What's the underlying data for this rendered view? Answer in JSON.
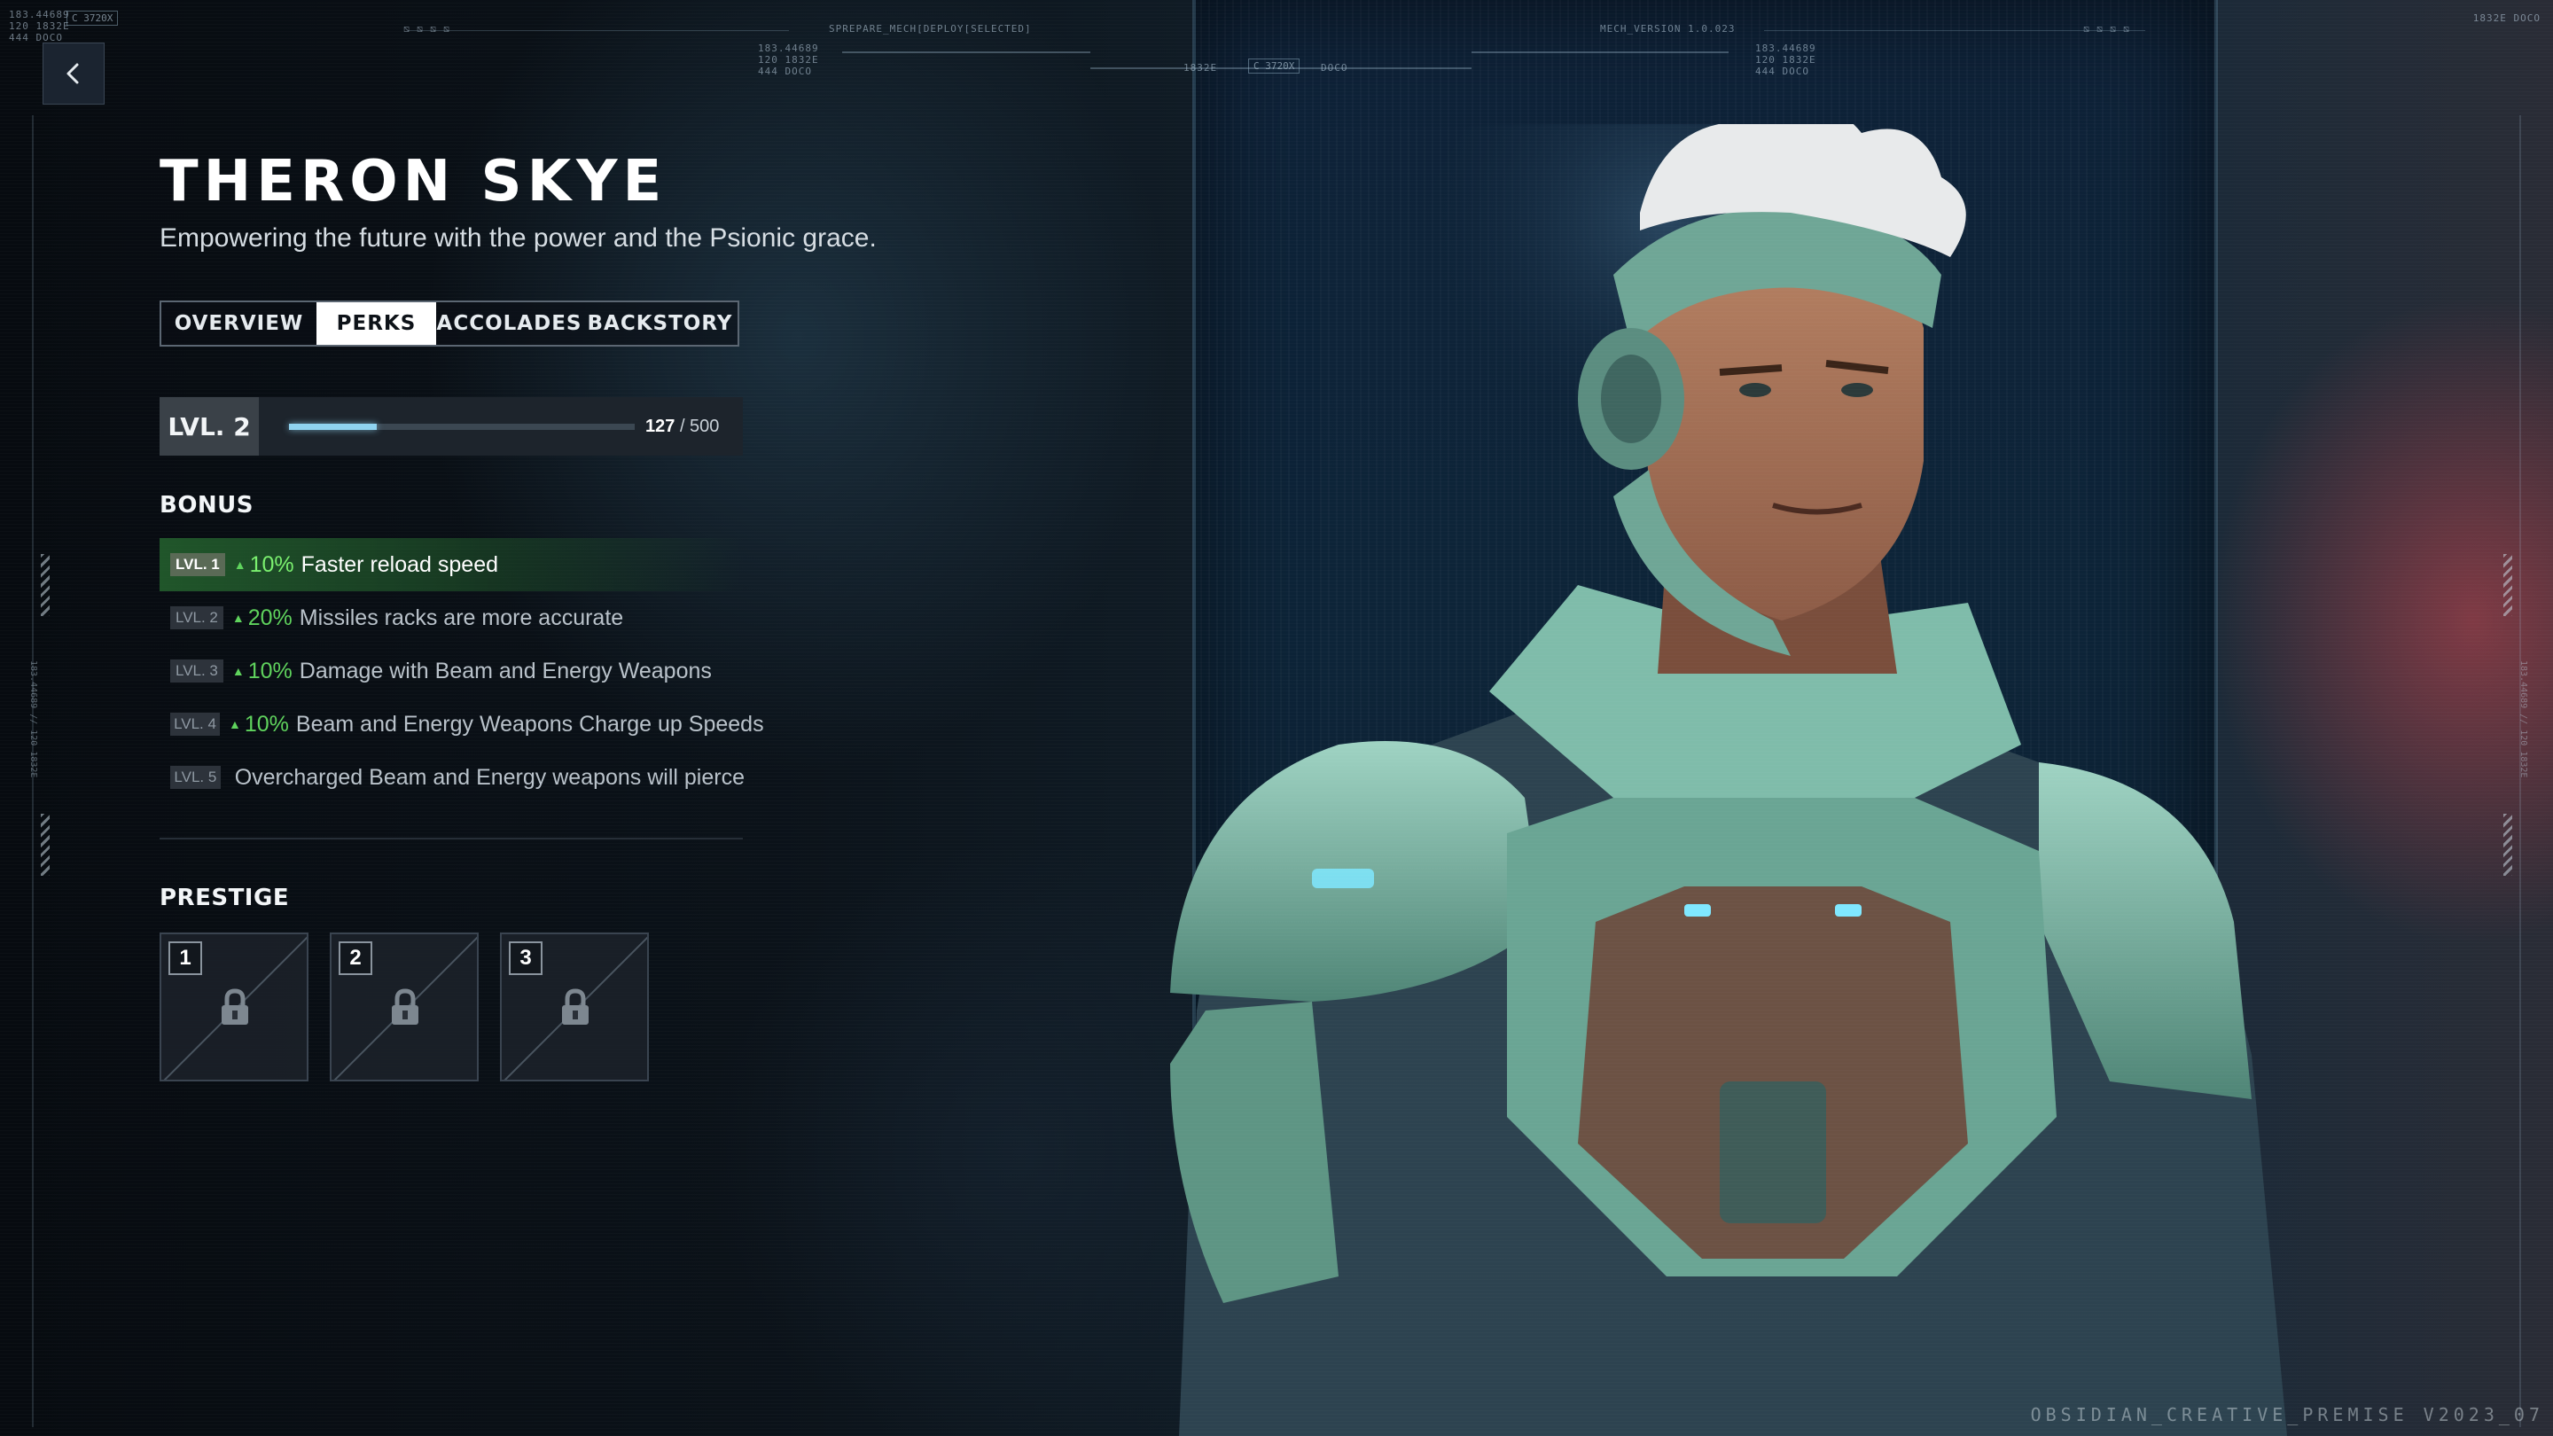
{
  "hud": {
    "top_left_code": "C 3720X",
    "top_left_lines": [
      "183.44689",
      "120 1832E",
      "444 DOCO"
    ],
    "center_label": "SPREPARE_MECH[DEPLOY[SELECTED]",
    "center_box_left": "1832E",
    "center_box_mid": "C 3720X",
    "center_box_right": "DOCO",
    "mech_version": "MECH_VERSION 1.0.023",
    "top_right_code": "1832E DOCO",
    "coords_a": [
      "183.44689",
      "120 1832E",
      "444 DOCO"
    ],
    "coords_b": [
      "183.44689",
      "120 1832E",
      "444 DOCO"
    ]
  },
  "nav": {
    "back_label": "Back"
  },
  "character": {
    "name": "THERON SKYE",
    "tagline": "Empowering the future with the power and the Psionic grace."
  },
  "tabs": [
    {
      "label": "OVERVIEW",
      "active": false
    },
    {
      "label": "PERKS",
      "active": true
    },
    {
      "label": "ACCOLADES",
      "active": false
    },
    {
      "label": "BACKSTORY",
      "active": false
    }
  ],
  "level": {
    "label": "LVL. 2",
    "xp_current": "127",
    "xp_separator": "/ 500",
    "progress_fraction": 0.254
  },
  "bonus": {
    "heading": "BONUS",
    "items": [
      {
        "level": "LVL. 1",
        "percent": "10%",
        "text": "Faster reload speed",
        "active": true
      },
      {
        "level": "LVL. 2",
        "percent": "20%",
        "text": "Missiles racks are more accurate",
        "active": false
      },
      {
        "level": "LVL. 3",
        "percent": "10%",
        "text": "Damage with Beam and Energy Weapons",
        "active": false
      },
      {
        "level": "LVL. 4",
        "percent": "10%",
        "text": "Beam and Energy Weapons Charge up Speeds",
        "active": false
      },
      {
        "level": "LVL. 5",
        "percent": "",
        "text": "Overcharged Beam and Energy weapons will pierce",
        "active": false
      }
    ]
  },
  "prestige": {
    "heading": "PRESTIGE",
    "slots": [
      {
        "number": "1"
      },
      {
        "number": "2"
      },
      {
        "number": "3"
      }
    ]
  },
  "footer": {
    "watermark": "OBSIDIAN_CREATIVE_PREMISE V2023_07"
  },
  "colors": {
    "accent_green": "#5fd35d",
    "progress_blue": "#8fd3f0",
    "active_row": "#2e6e32",
    "panel_bg": "#1d242c"
  }
}
